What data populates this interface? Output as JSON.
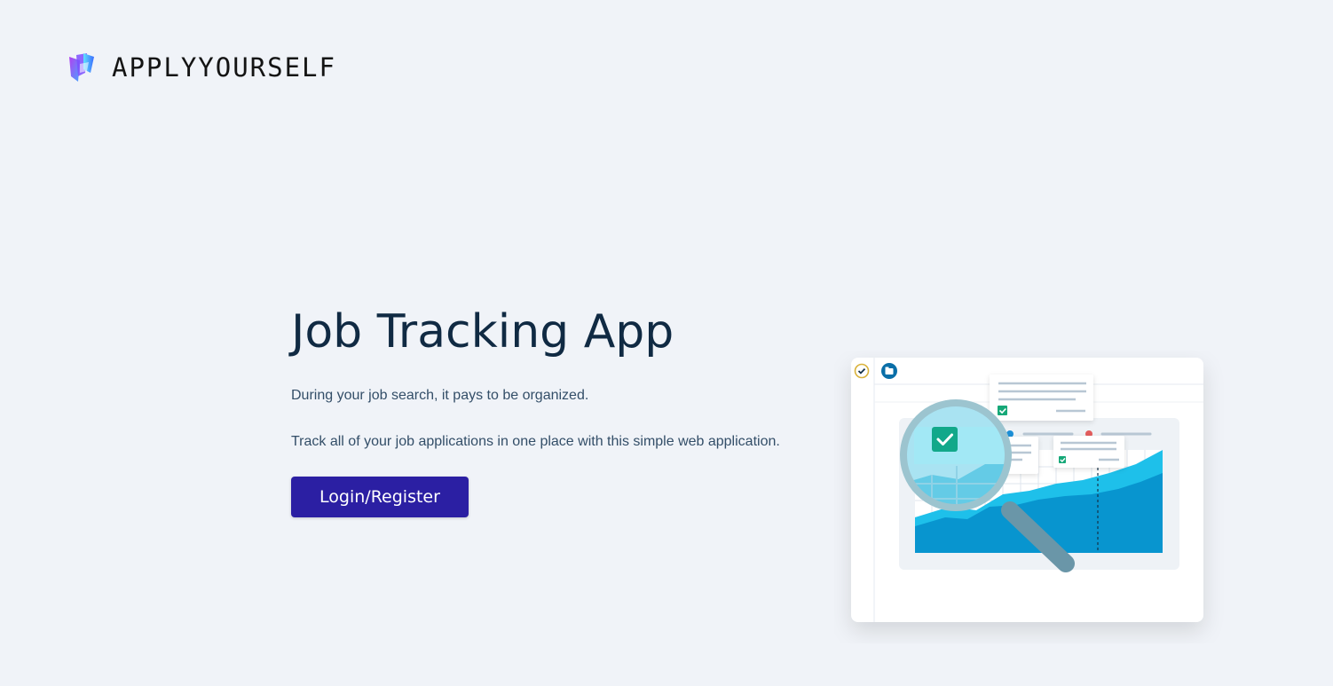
{
  "brand": {
    "name": "APPLYYOURSELF",
    "logo_icon": "logo-mark-icon"
  },
  "hero": {
    "title": "Job Tracking App",
    "paragraph_1": "During your job search, it pays to be organized.",
    "paragraph_2": "Track all of your job applications in one place with this simple web application.",
    "cta_label": "Login/Register"
  },
  "colors": {
    "background": "#f0f3f8",
    "primary_button": "#2b1fa3",
    "heading": "#102a43",
    "body_text": "#334e68",
    "illustration_accent": "#0ea5d8"
  },
  "illustration": {
    "name": "job-search-illustration",
    "icons": [
      "check-circle-icon",
      "folder-icon",
      "magnifying-glass-icon",
      "checkbox-checked-icon"
    ]
  }
}
